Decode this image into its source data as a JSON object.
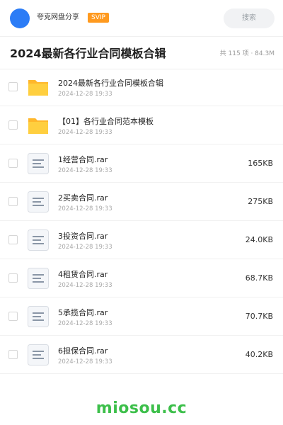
{
  "header": {
    "user_name": "夸克网盘分享",
    "badge": "SVIP",
    "search_placeholder": "搜索"
  },
  "title": "2024最新各行业合同模板合辑",
  "summary": "共 115 项 · 84.3M",
  "items": [
    {
      "name": "2024最新各行业合同模板合辑",
      "date": "2024-12-28 19:33",
      "size": "",
      "icon": "folder-icon"
    },
    {
      "name": "【01】各行业合同范本模板",
      "date": "2024-12-28 19:33",
      "size": "",
      "icon": "folder-icon"
    },
    {
      "name": "1经营合同.rar",
      "date": "2024-12-28 19:33",
      "size": "165KB",
      "icon": "file-icon"
    },
    {
      "name": "2买卖合同.rar",
      "date": "2024-12-28 19:33",
      "size": "275KB",
      "icon": "file-icon"
    },
    {
      "name": "3投资合同.rar",
      "date": "2024-12-28 19:33",
      "size": "24.0KB",
      "icon": "file-icon"
    },
    {
      "name": "4租赁合同.rar",
      "date": "2024-12-28 19:33",
      "size": "68.7KB",
      "icon": "file-icon"
    },
    {
      "name": "5承揽合同.rar",
      "date": "2024-12-28 19:33",
      "size": "70.7KB",
      "icon": "file-icon"
    },
    {
      "name": "6担保合同.rar",
      "date": "2024-12-28 19:33",
      "size": "40.2KB",
      "icon": "file-icon"
    }
  ],
  "watermark": "miosou.cc",
  "colors": {
    "accent": "#2b7cf6",
    "badge": "#ff9a1f",
    "folder": "#ffc83d",
    "watermark": "#3cbf4a"
  }
}
